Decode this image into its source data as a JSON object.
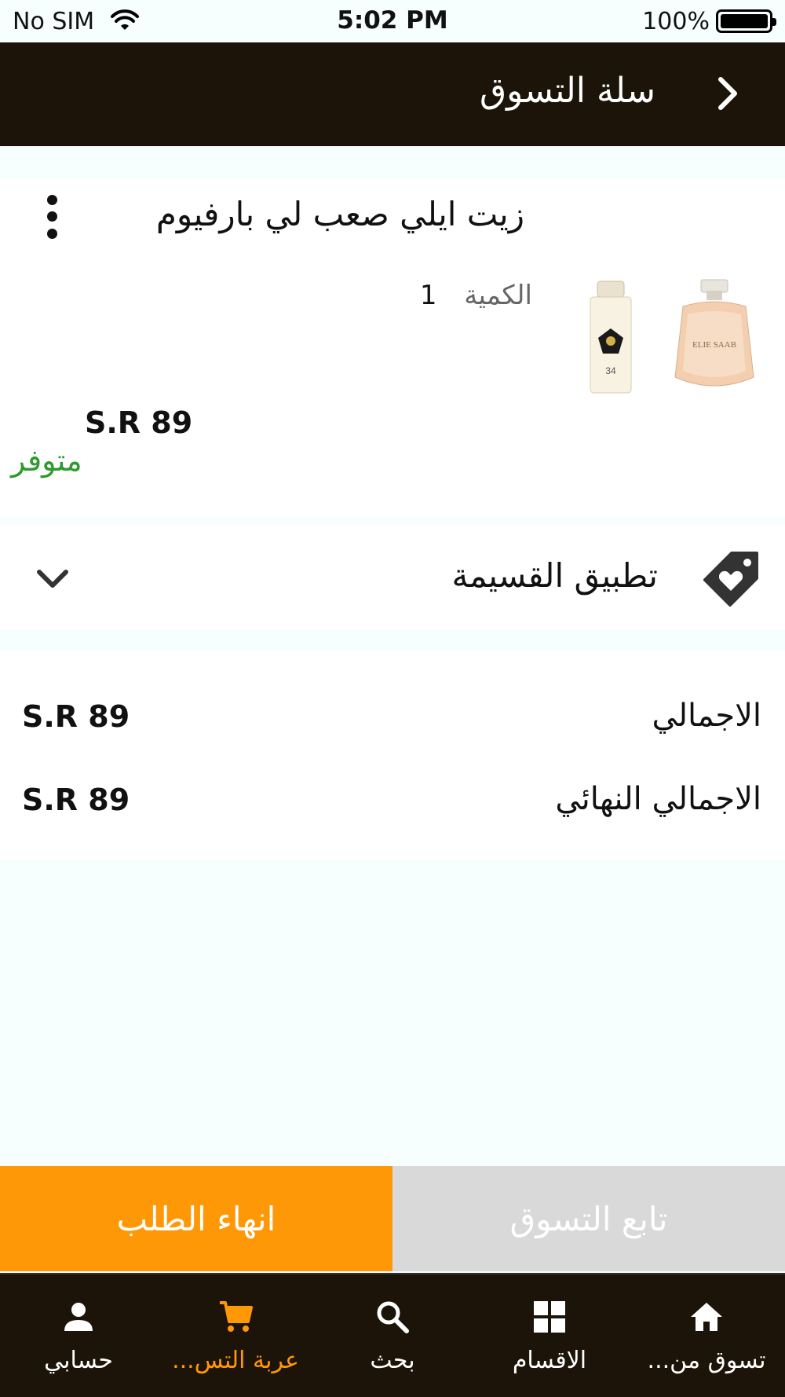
{
  "status_bar": {
    "carrier": "No SIM",
    "time": "5:02 PM",
    "battery": "100%"
  },
  "nav": {
    "title": "سلة التسوق"
  },
  "cart_item": {
    "name": "زيت ايلي صعب لي بارفيوم",
    "quantity_label": "الكمية",
    "quantity": "1",
    "price": "S.R 89",
    "stock_status": "متوفر",
    "bottle1_brand": "ELIE SAAB",
    "bottle2_number": "34"
  },
  "coupon": {
    "label": "تطبيق القسيمة"
  },
  "totals": {
    "subtotal_label": "الاجمالي",
    "subtotal_value": "S.R 89",
    "grand_total_label": "الاجمالي النهائي",
    "grand_total_value": "S.R 89"
  },
  "actions": {
    "checkout": "انهاء الطلب",
    "continue_shopping": "تابع التسوق"
  },
  "tabs": [
    {
      "label": "حسابي",
      "icon": "person-icon"
    },
    {
      "label": "عربة التس...",
      "icon": "cart-icon",
      "active": true
    },
    {
      "label": "بحث",
      "icon": "search-icon"
    },
    {
      "label": "الاقسام",
      "icon": "grid-icon"
    },
    {
      "label": "تسوق من...",
      "icon": "home-icon"
    }
  ],
  "colors": {
    "header": "#1c1408",
    "accent": "#ff9806",
    "in_stock": "#2e9a2e",
    "secondary_button": "#d9d9d9",
    "background": "#f6fffe"
  }
}
